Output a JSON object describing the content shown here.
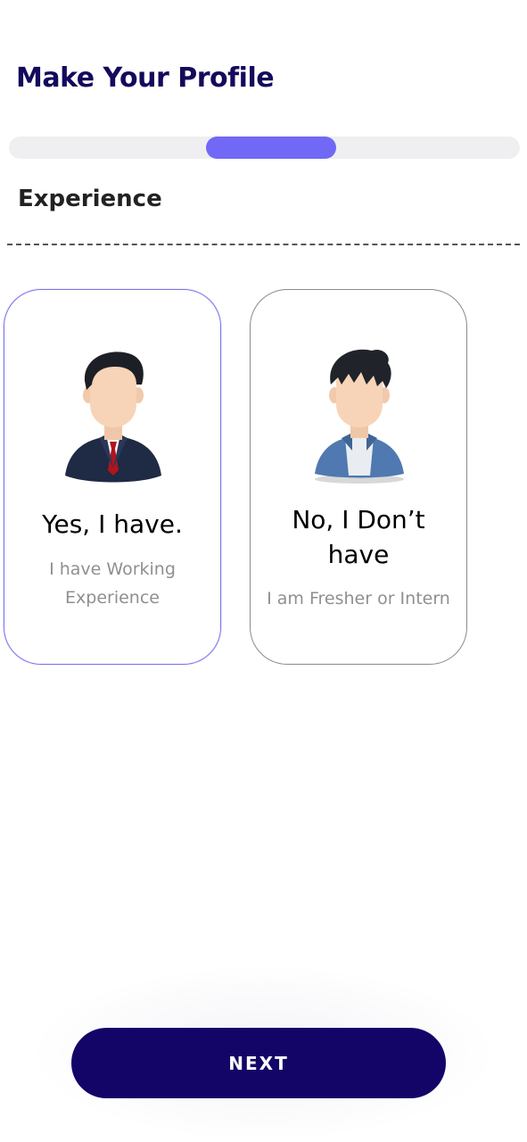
{
  "header": {
    "title": "Make Your Profile"
  },
  "progress": {
    "step_start_fraction": 0.385,
    "step_end_fraction": 0.64
  },
  "section": {
    "label": "Experience"
  },
  "options": [
    {
      "title_line1": "Yes, I have.",
      "title_line2": "",
      "subtitle_line1": "I have Working",
      "subtitle_line2": "Experience",
      "avatar_icon": "professional-man-suit-avatar-icon",
      "selected": true
    },
    {
      "title_line1": "No, I Don’t",
      "title_line2": "have",
      "subtitle_line1": "I am Fresher or Intern",
      "subtitle_line2": "",
      "avatar_icon": "young-man-casual-avatar-icon",
      "selected": false
    }
  ],
  "actions": {
    "next_label": "NEXT"
  },
  "colors": {
    "title": "#140a5c",
    "accent": "#7169f6",
    "button": "#130468",
    "selected_border": "#7a74ee"
  }
}
